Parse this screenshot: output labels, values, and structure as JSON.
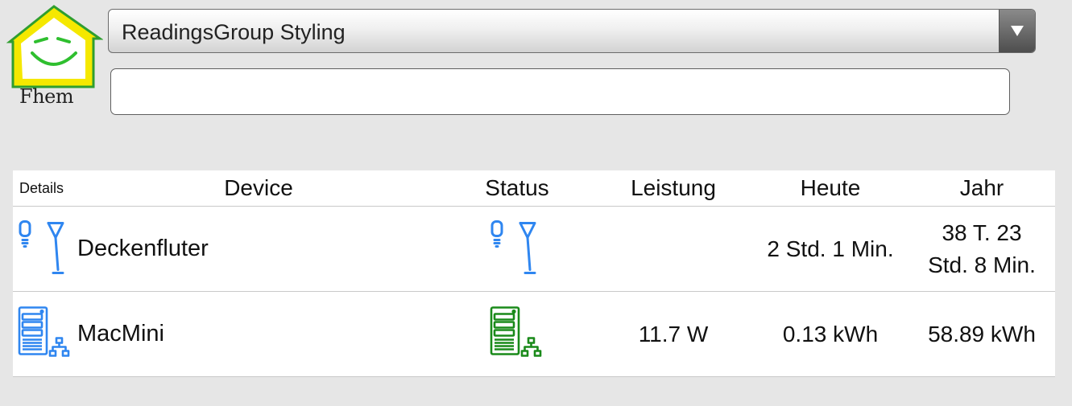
{
  "logo": {
    "text": "Fhem",
    "house_color": "#f5e800",
    "house_outline": "#2f9e2f",
    "face_color": "#2fbf2f"
  },
  "room_select": {
    "selected": "ReadingsGroup Styling"
  },
  "command_input": {
    "value": "",
    "placeholder": ""
  },
  "table": {
    "headers": {
      "details": "Details",
      "device": "Device",
      "status": "Status",
      "leistung": "Leistung",
      "heute": "Heute",
      "jahr": "Jahr"
    },
    "rows": [
      {
        "name": "Deckenfluter",
        "icon": "lamp-antenna-icon",
        "status_icon": "lamp-antenna-icon",
        "leistung": "",
        "heute": "2 Std. 1 Min.",
        "jahr_line1": "38 T. 23",
        "jahr_line2": "Std. 8 Min."
      },
      {
        "name": "MacMini",
        "icon": "server-network-icon",
        "status_icon": "server-network-icon",
        "leistung": "11.7 W",
        "heute": "0.13 kWh",
        "jahr": "58.89 kWh"
      }
    ]
  },
  "colors": {
    "background": "#e6e6e6",
    "icon_blue": "#2f86f0",
    "icon_green": "#1a8a1a"
  }
}
